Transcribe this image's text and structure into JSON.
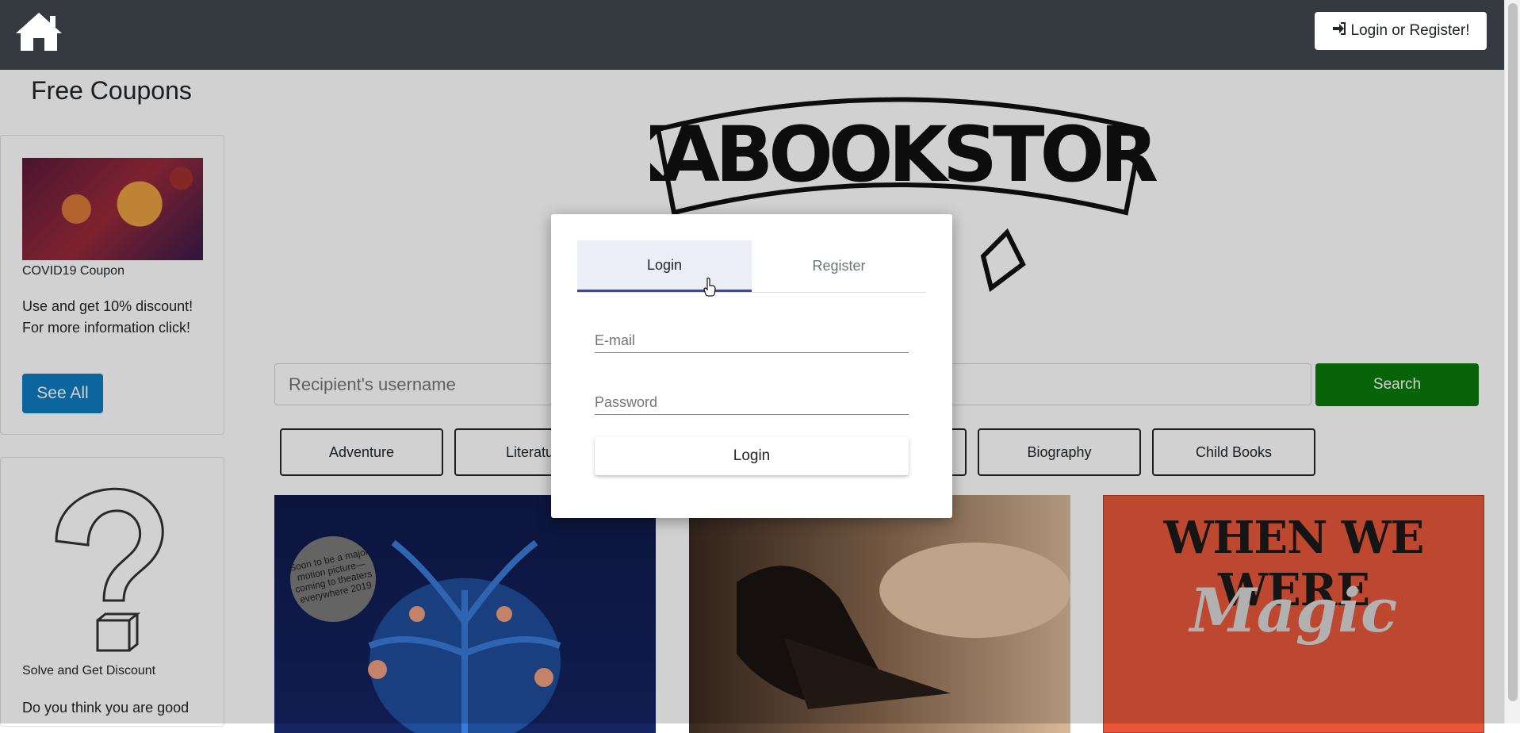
{
  "header": {
    "home_icon": "home-icon",
    "login_button_label": "Login or Register!",
    "login_button_icon": "sign-in-icon"
  },
  "sidebar": {
    "title": "Free Coupons",
    "coupon": {
      "caption": "COVID19 Coupon",
      "text": "Use and get 10% discount! For more information click!",
      "button_label": "See All"
    },
    "quiz": {
      "caption": "Solve and Get Discount",
      "text": "Do you think you are good"
    }
  },
  "main": {
    "logo_text": "KABOOKSTORE",
    "search": {
      "placeholder": "Recipient's username",
      "button_label": "Search"
    },
    "categories": [
      "Adventure",
      "Literature",
      "",
      "",
      "Biography",
      "Child Books"
    ],
    "books": [
      {
        "badge": "Soon to be a major motion picture—coming to theaters everywhere 2019"
      },
      {},
      {
        "title_line1": "WHEN WE WERE",
        "title_line2": "Magic"
      }
    ]
  },
  "modal": {
    "tabs": [
      {
        "label": "Login",
        "active": true
      },
      {
        "label": "Register",
        "active": false
      }
    ],
    "email_placeholder": "E-mail",
    "password_placeholder": "Password",
    "submit_label": "Login"
  },
  "colors": {
    "header_bg": "#343a40",
    "search_button": "#0a7a0a",
    "see_all_button": "#117cc0",
    "active_tab_underline": "#3949ab"
  }
}
